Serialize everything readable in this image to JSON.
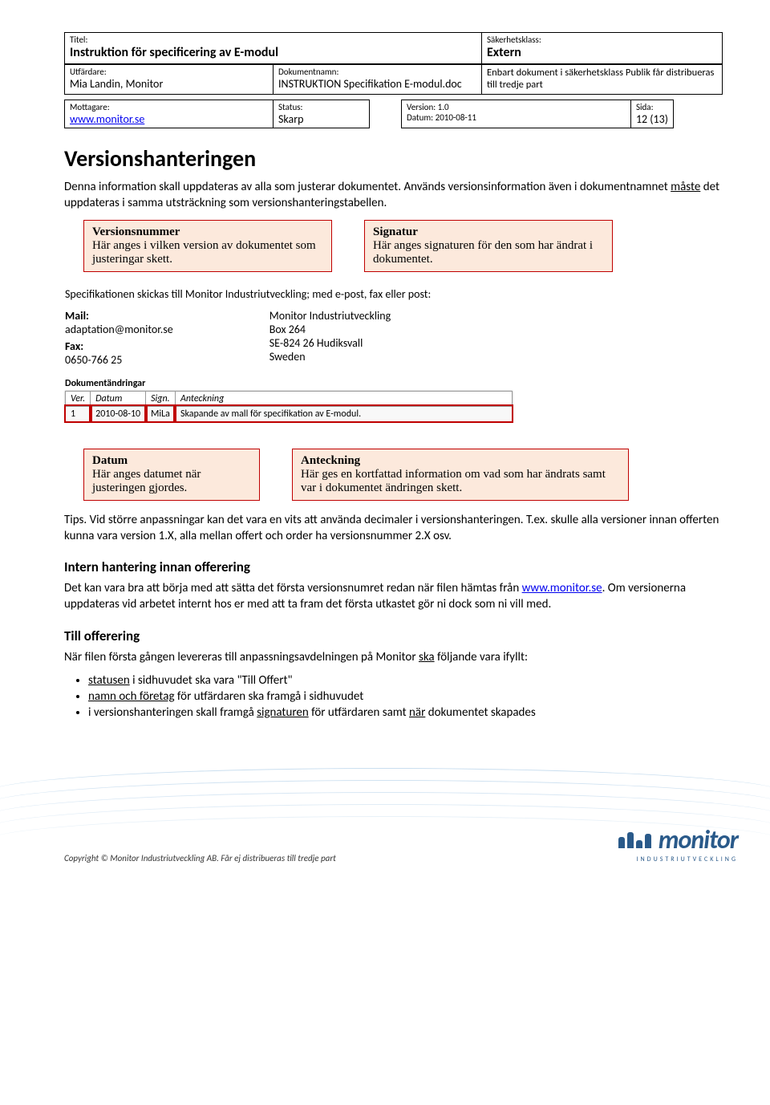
{
  "header": {
    "titel_label": "Titel:",
    "titel_value": "Instruktion för specificering av E-modul",
    "utfardare_label": "Utfärdare:",
    "utfardare_value": "Mia Landin, Monitor",
    "doknamn_label": "Dokumentnamn:",
    "doknamn_value": "INSTRUKTION Specifikation E-modul.doc",
    "sakerhet_label": "Säkerhetsklass:",
    "sakerhet_value": "Extern",
    "sakerhet_note": "Enbart dokument i säkerhetsklass Publik får distribueras till tredje part",
    "mottagare_label": "Mottagare:",
    "mottagare_value": "www.monitor.se",
    "status_label": "Status:",
    "status_value": "Skarp",
    "version_label": "Version: 1.0",
    "datum_label": "Datum: 2010-08-11",
    "sida_label": "Sida:",
    "sida_value": "12 (13)"
  },
  "main": {
    "h1": "Versionshanteringen",
    "p1a": "Denna information skall uppdateras av alla som justerar dokumentet. Används versionsinformation även i dokumentnamnet ",
    "p1_u": "måste",
    "p1b": " det uppdateras i samma utsträckning som versionshanteringstabellen.",
    "c_ver_t": "Versionsnummer",
    "c_ver_b": "Här anges i vilken version av dokumentet som justeringar skett.",
    "c_sig_t": "Signatur",
    "c_sig_b": "Här anges signaturen för den som har ändrat i dokumentet.",
    "ss_intro": "Specifikationen skickas till Monitor Industriutveckling; med e-post, fax eller post:",
    "ss_mail_h": "Mail:",
    "ss_mail_v": "adaptation@monitor.se",
    "ss_fax_h": "Fax:",
    "ss_fax_v": "0650-766 25",
    "ss_addr1": "Monitor Industriutveckling",
    "ss_addr2": "Box 264",
    "ss_addr3": "SE-824 26 Hudiksvall",
    "ss_addr4": "Sweden",
    "ss_tbl_h": "Dokumentändringar",
    "tbl": {
      "ver_h": "Ver.",
      "datum_h": "Datum",
      "sign_h": "Sign.",
      "ant_h": "Anteckning",
      "ver": "1",
      "datum": "2010-08-10",
      "sign": "MiLa",
      "ant": "Skapande av mall för specifikation av E-modul."
    },
    "c_dat_t": "Datum",
    "c_dat_b": "Här anges datumet när justeringen gjordes.",
    "c_ant_t": "Anteckning",
    "c_ant_b": "Här ges en kortfattad information om vad som har ändrats samt var i dokumentet ändringen skett.",
    "tips": "Tips. Vid större anpassningar kan det vara en vits att använda decimaler i versionshanteringen. T.ex. skulle alla versioner innan offerten kunna vara version 1.X, alla mellan offert och order ha versionsnummer 2.X osv.",
    "h2a": "Intern hantering innan offerering",
    "p2a": "Det kan vara bra att börja med att sätta det första versionsnumret redan när filen hämtas från ",
    "p2_link": "www.monitor.se",
    "p2b": ". Om versionerna uppdateras vid arbetet internt hos er med att ta fram det första utkastet gör ni dock som ni vill med.",
    "h2b": "Till offerering",
    "p3a": "När filen första gången levereras till anpassningsavdelningen på Monitor ",
    "p3_u": "ska",
    "p3b": " följande vara ifyllt:",
    "b1a": "statusen",
    "b1b": " i sidhuvudet ska vara \"Till Offert\"",
    "b2a": "namn och företag",
    "b2b": " för utfärdaren ska framgå i sidhuvudet",
    "b3a": "i versionshanteringen skall framgå ",
    "b3u1": "signaturen",
    "b3b": " för utfärdaren samt ",
    "b3u2": "när",
    "b3c": " dokumentet skapades"
  },
  "footer": {
    "copyright": "Copyright © Monitor Industriutveckling AB. Får ej distribueras till tredje part",
    "logo_text": "monitor",
    "logo_sub": "INDUSTRIUTVECKLING"
  }
}
